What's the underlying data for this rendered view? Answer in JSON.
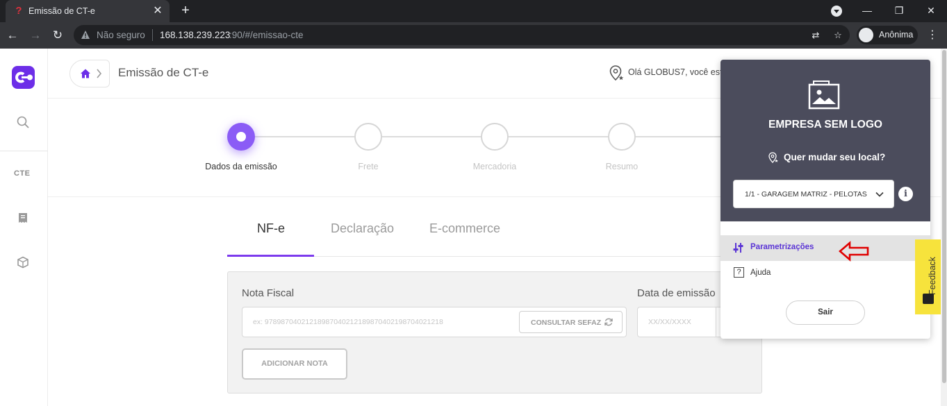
{
  "browser": {
    "tab_title": "Emissão de CT-e",
    "favicon": "?",
    "security_label": "Não seguro",
    "url_host": "168.138.239.223",
    "url_path": ":90/#/emissao-cte",
    "profile_label": "Anônima"
  },
  "sidebar": {
    "cte_label": "CTE",
    "accent_color": "#6d2ee8"
  },
  "header": {
    "page_title": "Emissão de CT-e",
    "greeting": "Olá GLOBUS7, você est"
  },
  "stepper": {
    "steps": [
      {
        "label": "Dados da emissão",
        "active": true
      },
      {
        "label": "Frete",
        "active": false
      },
      {
        "label": "Mercadoria",
        "active": false
      },
      {
        "label": "Resumo",
        "active": false
      }
    ]
  },
  "tabs": [
    {
      "label": "NF-e",
      "active": true
    },
    {
      "label": "Declaração",
      "active": false
    },
    {
      "label": "E-commerce",
      "active": false
    }
  ],
  "form": {
    "nota_label": "Nota Fiscal",
    "nota_placeholder": "ex: 97898704021218987040212189870402198704021218",
    "consultar_label": "CONSULTAR SEFAZ",
    "date_label": "Data de emissão",
    "date_placeholder": "XX/XX/XXXX",
    "add_label": "ADICIONAR NOTA"
  },
  "dropdown": {
    "company": "EMPRESA SEM LOGO",
    "change_location": "Quer mudar seu local?",
    "location_value": "1/1 - GARAGEM MATRIZ - PELOTAS",
    "info": "i",
    "items": [
      {
        "label": "Parametrizações",
        "icon": "sliders-icon",
        "highlighted": true
      },
      {
        "label": "Ajuda",
        "icon": "help-icon",
        "highlighted": false
      }
    ],
    "logout_label": "Sair"
  },
  "feedback": {
    "label": "Feedback",
    "color": "#f7e33c"
  },
  "annotation": {
    "arrow_color": "#e00000"
  }
}
